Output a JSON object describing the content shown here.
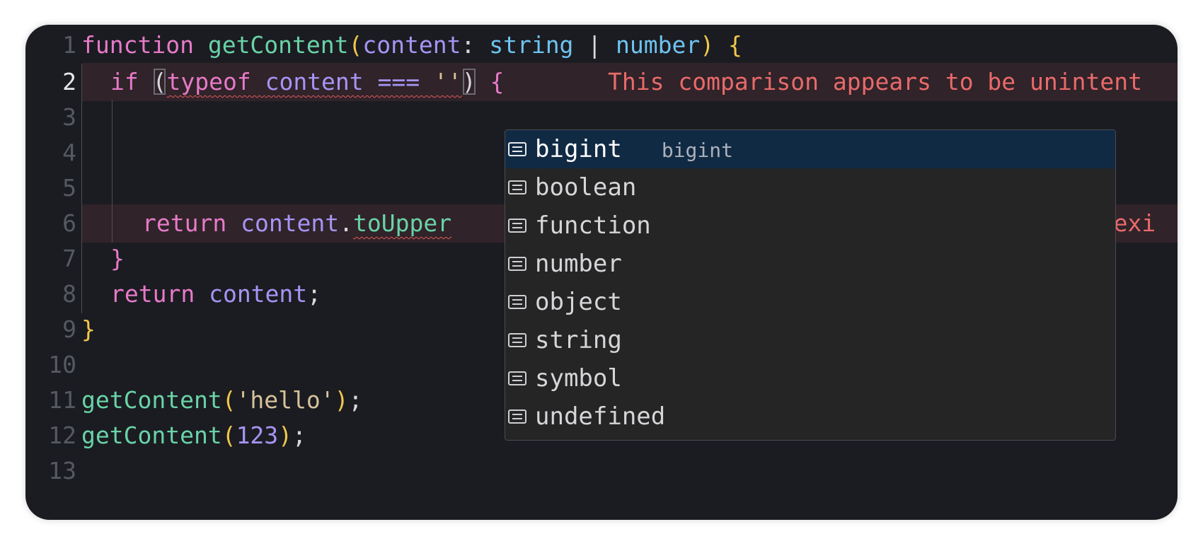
{
  "editor": {
    "line_numbers": [
      "1",
      "2",
      "3",
      "4",
      "5",
      "6",
      "7",
      "8",
      "9",
      "10",
      "11",
      "12",
      "13"
    ],
    "active_line": "2",
    "code": {
      "l1": {
        "t1": "function",
        "t2": "getContent",
        "t3": "(",
        "t4": "content",
        "t5": ": ",
        "t6": "string",
        "t7": " | ",
        "t8": "number",
        "t9": ")",
        "t10": " ",
        "t11": "{"
      },
      "l2": {
        "t1": "if ",
        "t2": "(",
        "t3": "typeof",
        "t4": " ",
        "t5": "content",
        "t6": " === ",
        "t7": "''",
        "t8": ")",
        "t9": " {",
        "hint": "This comparison appears to be unintent"
      },
      "l6": {
        "t1": "return ",
        "t2": "content",
        "t3": ".",
        "t4": "toUpper",
        "hint": "ot exi"
      },
      "l7": {
        "t1": "}"
      },
      "l8": {
        "t1": "return ",
        "t2": "content",
        "t3": ";"
      },
      "l9": {
        "t1": "}"
      },
      "l11": {
        "t1": "getContent",
        "t2": "(",
        "t3": "'hello'",
        "t4": ")",
        "t5": ";"
      },
      "l12": {
        "t1": "getContent",
        "t2": "(",
        "t3": "123",
        "t4": ")",
        "t5": ";"
      }
    }
  },
  "suggest": {
    "icon": "text-icon",
    "items": [
      {
        "label": "bigint",
        "detail": "bigint"
      },
      {
        "label": "boolean",
        "detail": ""
      },
      {
        "label": "function",
        "detail": ""
      },
      {
        "label": "number",
        "detail": ""
      },
      {
        "label": "object",
        "detail": ""
      },
      {
        "label": "string",
        "detail": ""
      },
      {
        "label": "symbol",
        "detail": ""
      },
      {
        "label": "undefined",
        "detail": ""
      }
    ]
  },
  "colors": {
    "background": "#1b1c21",
    "keyword": "#e77ac9",
    "function": "#69d3a7",
    "variable": "#a794f5",
    "type": "#6ec3f0",
    "bracket": "#f1c84c",
    "string": "#d6c29a",
    "error": "#f16a6a",
    "suggest_selected": "#112a44"
  }
}
